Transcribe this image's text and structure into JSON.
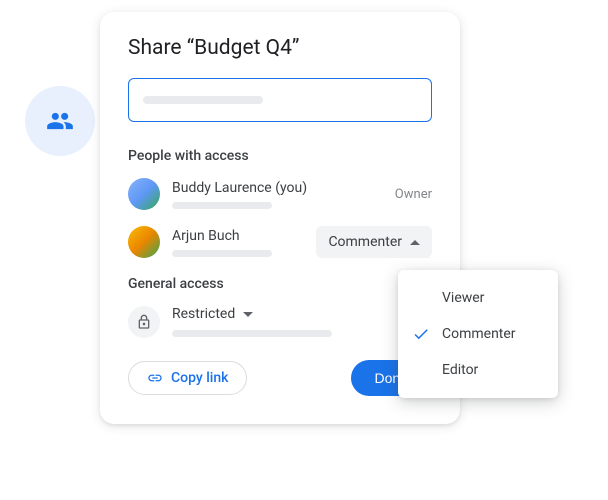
{
  "dialog": {
    "title": "Share “Budget Q4”",
    "sections": {
      "people_label": "People with access",
      "general_label": "General access"
    }
  },
  "people": [
    {
      "name": "Buddy Laurence (you)",
      "role": "Owner"
    },
    {
      "name": "Arjun Buch",
      "role": "Commenter"
    }
  ],
  "general_access": {
    "mode": "Restricted"
  },
  "footer": {
    "copy_link": "Copy link",
    "done": "Done"
  },
  "role_menu": {
    "options": [
      {
        "label": "Viewer",
        "selected": false
      },
      {
        "label": "Commenter",
        "selected": true
      },
      {
        "label": "Editor",
        "selected": false
      }
    ]
  }
}
